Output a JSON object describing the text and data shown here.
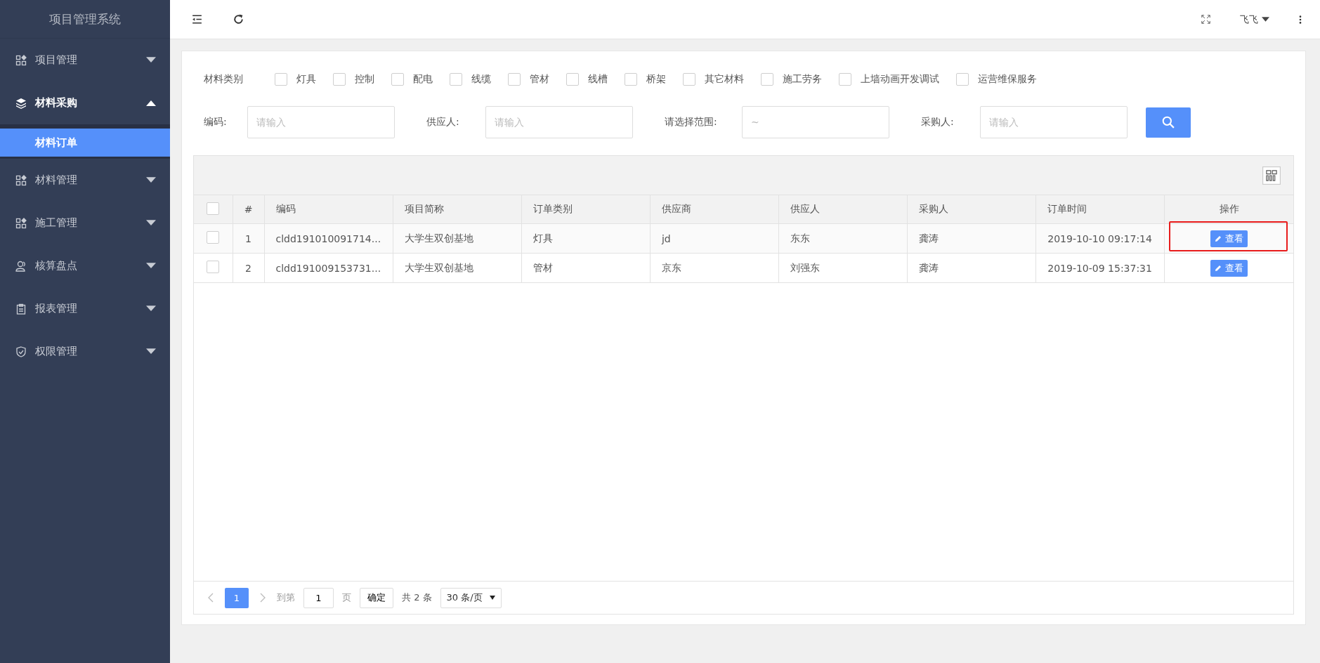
{
  "sidebar": {
    "title": "项目管理系统",
    "items": [
      {
        "label": "项目管理",
        "expanded": false
      },
      {
        "label": "材料采购",
        "expanded": true,
        "children": [
          {
            "label": "材料订单",
            "selected": true
          }
        ]
      },
      {
        "label": "材料管理",
        "expanded": false
      },
      {
        "label": "施工管理",
        "expanded": false
      },
      {
        "label": "核算盘点",
        "expanded": false
      },
      {
        "label": "报表管理",
        "expanded": false
      },
      {
        "label": "权限管理",
        "expanded": false
      }
    ]
  },
  "topbar": {
    "user": "飞飞"
  },
  "filters": {
    "category_label": "材料类别",
    "categories": [
      {
        "label": "灯具",
        "checked": false
      },
      {
        "label": "控制",
        "checked": false
      },
      {
        "label": "配电",
        "checked": false
      },
      {
        "label": "线缆",
        "checked": false
      },
      {
        "label": "管材",
        "checked": false
      },
      {
        "label": "线槽",
        "checked": false
      },
      {
        "label": "桥架",
        "checked": false
      },
      {
        "label": "其它材料",
        "checked": false
      },
      {
        "label": "施工劳务",
        "checked": false
      },
      {
        "label": "上墙动画开发调试",
        "checked": false
      },
      {
        "label": "运营维保服务",
        "checked": false
      }
    ],
    "fields": [
      {
        "label": "编码:",
        "placeholder": "请输入"
      },
      {
        "label": "供应人:",
        "placeholder": "请输入"
      },
      {
        "label": "请选择范围:",
        "placeholder": "~"
      },
      {
        "label": "采购人:",
        "placeholder": "请输入"
      }
    ]
  },
  "table": {
    "all_checked": false,
    "columns": [
      "#",
      "编码",
      "项目简称",
      "订单类别",
      "供应商",
      "供应人",
      "采购人",
      "订单时间",
      "操作"
    ],
    "rows": [
      {
        "checked": false,
        "highlighted": true,
        "cells": [
          "1",
          "cldd191010091714...",
          "大学生双创基地",
          "灯具",
          "jd",
          "东东",
          "龚涛",
          "2019-10-10 09:17:14"
        ],
        "action": "查看"
      },
      {
        "checked": false,
        "highlighted": false,
        "cells": [
          "2",
          "cldd191009153731...",
          "大学生双创基地",
          "管材",
          "京东",
          "刘强东",
          "龚涛",
          "2019-10-09 15:37:31"
        ],
        "action": "查看"
      }
    ]
  },
  "pagination": {
    "pages": [
      {
        "label": "1",
        "selected": true
      }
    ],
    "goto_label": "到第",
    "goto_value": "1",
    "page_unit": "页",
    "confirm": "确定",
    "total": "共 2 条",
    "page_size": "30 条/页"
  }
}
